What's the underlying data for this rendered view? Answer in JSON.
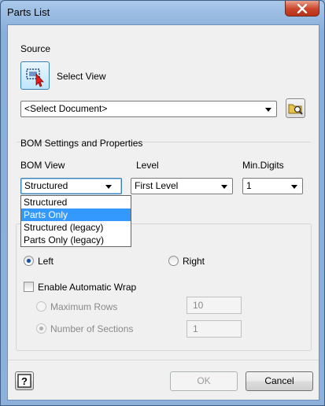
{
  "window": {
    "title": "Parts List"
  },
  "source": {
    "legend": "Source",
    "select_view_label": "Select View",
    "document_combo_value": "<Select Document>"
  },
  "bom": {
    "legend": "BOM Settings and Properties",
    "view_label": "BOM View",
    "level_label": "Level",
    "min_digits_label": "Min.Digits",
    "view_value": "Structured",
    "level_value": "First Level",
    "min_digits_value": "1",
    "view_options": [
      "Structured",
      "Parts Only",
      "Structured (legacy)",
      "Parts Only (legacy)"
    ],
    "view_highlighted_index": 1
  },
  "table_wrap": {
    "left_label": "Left",
    "right_label": "Right",
    "left_checked": true,
    "enable_wrap_label": "Enable Automatic Wrap",
    "max_rows_label": "Maximum Rows",
    "max_rows_value": "10",
    "num_sections_label": "Number of Sections",
    "num_sections_value": "1"
  },
  "buttons": {
    "ok_label": "OK",
    "cancel_label": "Cancel"
  },
  "colors": {
    "accent": "#3399ff",
    "close": "#c9442a",
    "title_bar": "#a9c8ea"
  },
  "icons": [
    "close-icon",
    "select-view-icon",
    "open-folder-icon",
    "help-icon",
    "chevron-down-icon"
  ]
}
